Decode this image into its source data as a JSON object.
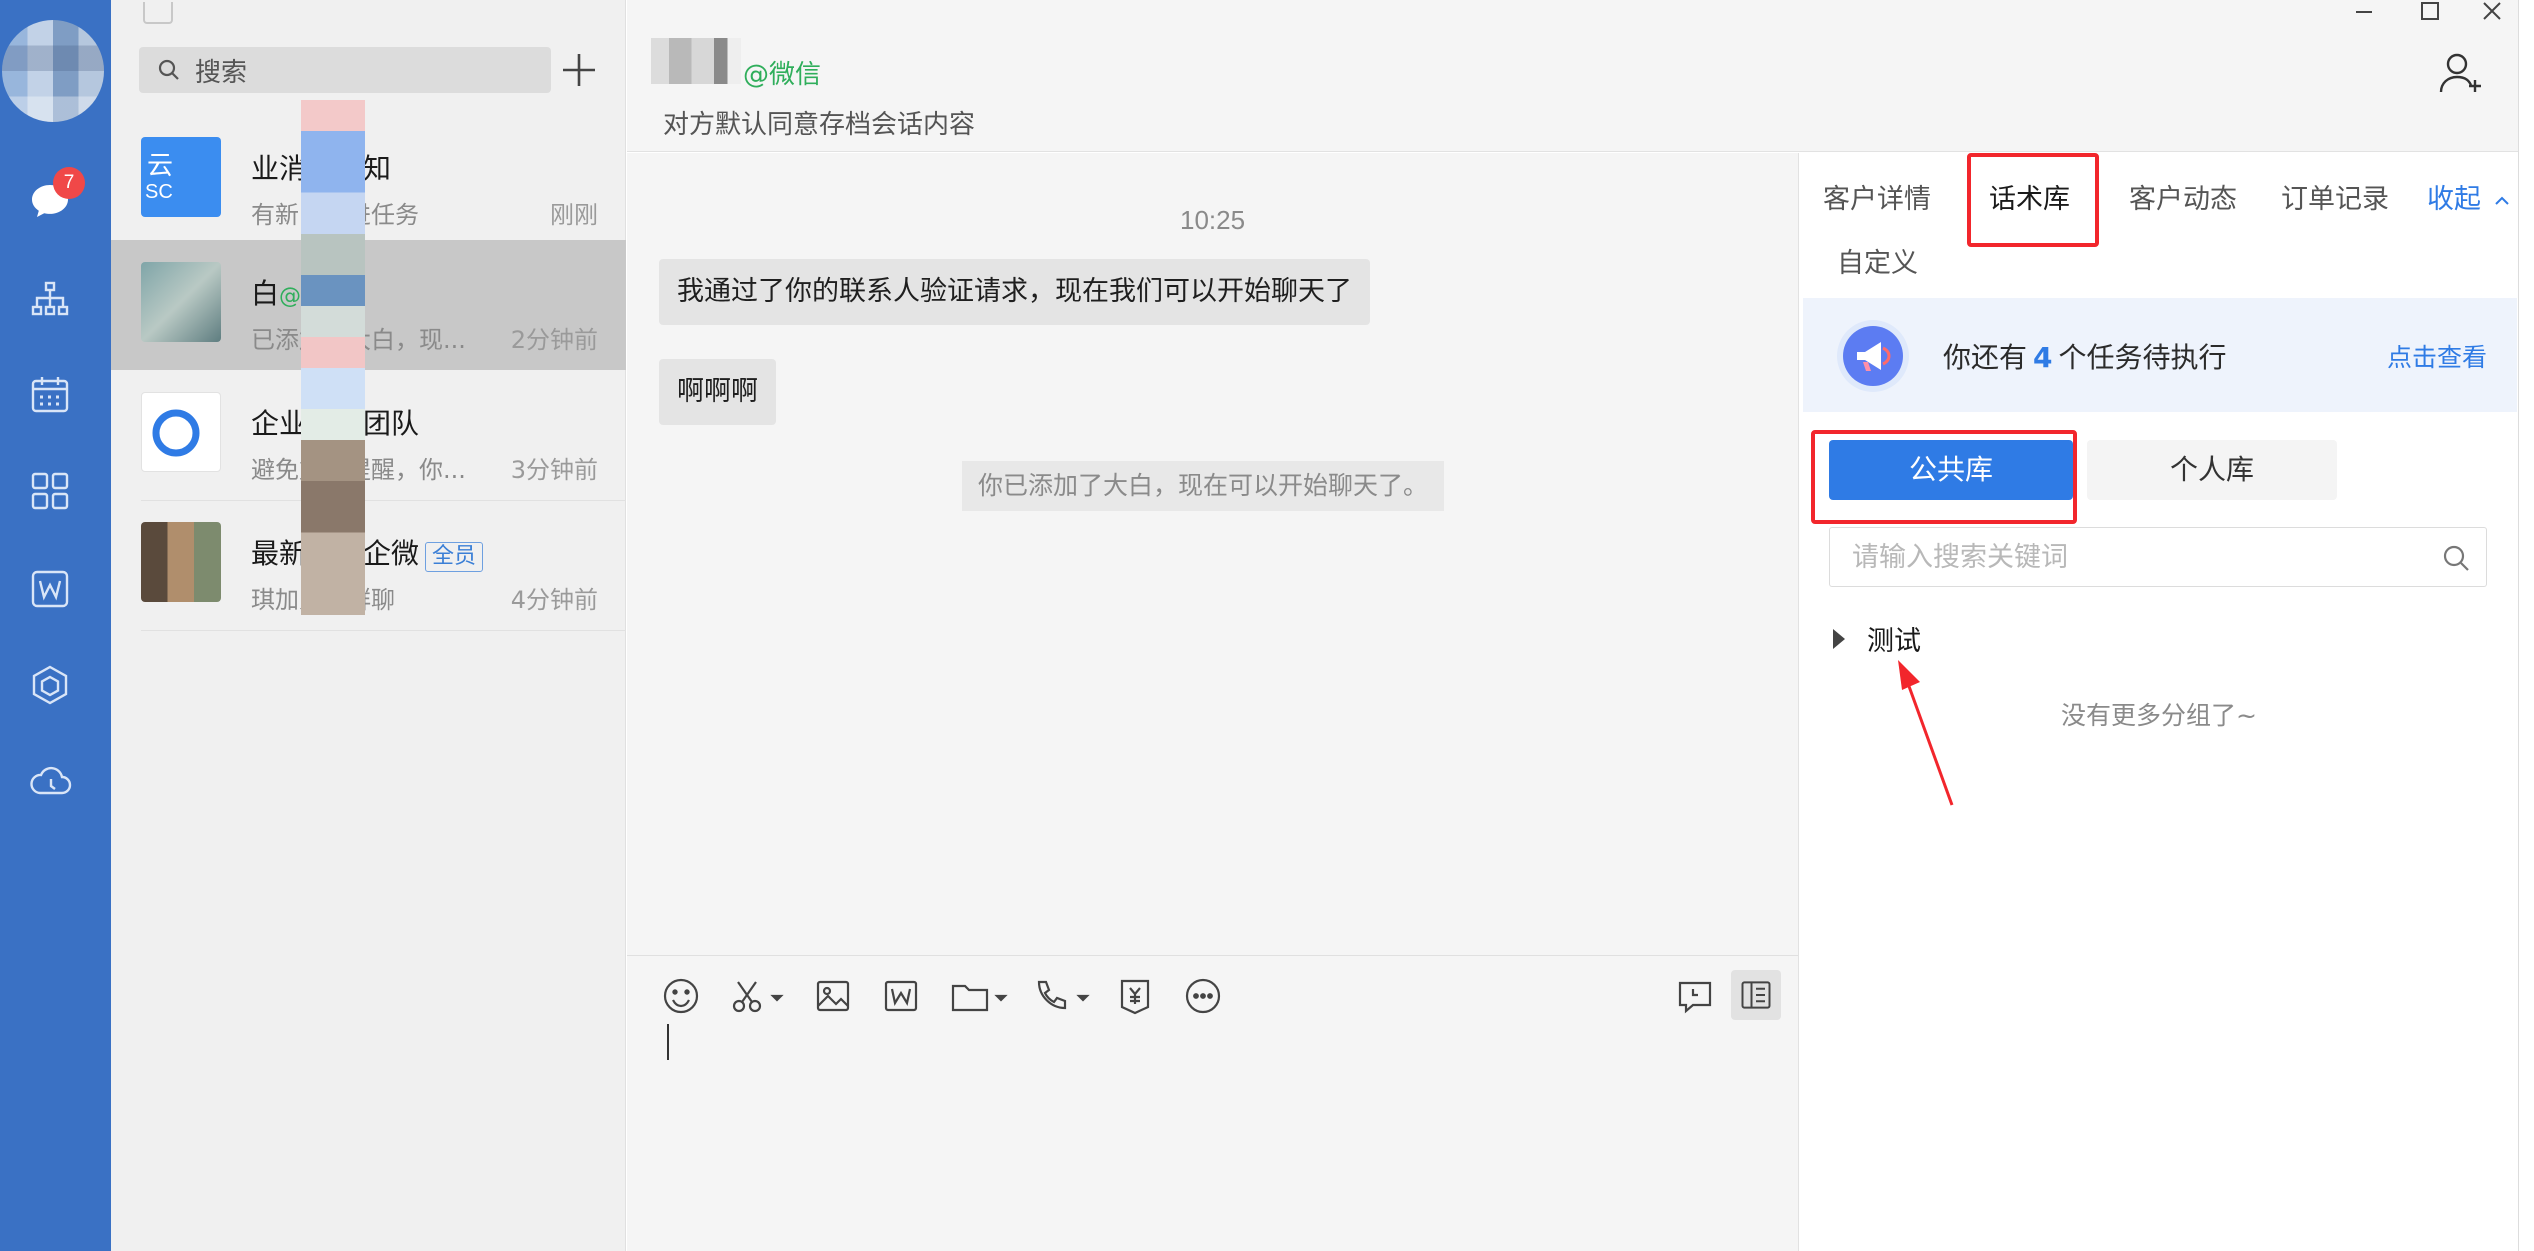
{
  "rail": {
    "badge_count": "7",
    "icons": [
      "chat-bubble-icon",
      "org-chart-icon",
      "calendar-icon",
      "apps-grid-icon",
      "document-w-icon",
      "cube-icon",
      "cloud-icon"
    ]
  },
  "sidebar": {
    "search_placeholder": "搜索",
    "conversations": [
      {
        "name": "业消息通知",
        "preview": "有新的跟进任务",
        "time": "刚刚",
        "tag": ""
      },
      {
        "name": "白",
        "tag_wx": "@微信",
        "preview": "已添加了大白，现...",
        "time": "2分钟前"
      },
      {
        "name": "企业微信团队",
        "preview": "避免重复提醒，你...",
        "time": "3分钟前"
      },
      {
        "name": "最新测试企微",
        "tag_all": "全员",
        "preview": "琪加入了群聊",
        "time": "4分钟前"
      }
    ]
  },
  "chat": {
    "contact_tag": "@微信",
    "subtitle": "对方默认同意存档会话内容",
    "time": "10:25",
    "messages": [
      {
        "text": "我通过了你的联系人验证请求，现在我们可以开始聊天了"
      },
      {
        "text": "啊啊啊"
      }
    ],
    "system_msg": "你已添加了大白，现在可以开始聊天了。"
  },
  "panel": {
    "tabs": [
      "客户详情",
      "话术库",
      "客户动态",
      "订单记录",
      "收起",
      "自定义"
    ],
    "task_prefix": "你还有",
    "task_count": "4",
    "task_suffix": "个任务待执行",
    "task_link": "点击查看",
    "public_lib": "公共库",
    "personal_lib": "个人库",
    "search_placeholder": "请输入搜索关键词",
    "group_name": "测试",
    "no_more": "没有更多分组了~"
  },
  "colors": {
    "rail": "#3a71c4",
    "accent": "#2f7be5",
    "highlight_red": "#f2262c",
    "wechat_green": "#2fae5b",
    "badge_red": "#f04848"
  }
}
